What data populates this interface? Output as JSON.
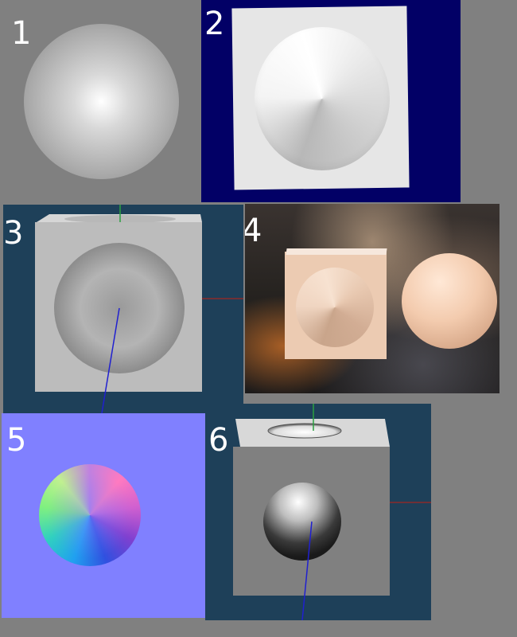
{
  "panels": [
    {
      "number": "1"
    },
    {
      "number": "2"
    },
    {
      "number": "3"
    },
    {
      "number": "4"
    },
    {
      "number": "5"
    },
    {
      "number": "6"
    }
  ],
  "colors": {
    "page_background": "#808080",
    "panel2_background": "#020066",
    "viewport_background": "#1e4059",
    "normal_map_background": "#8080ff",
    "axis_x": "#8a2a2a",
    "axis_y": "#2aa040",
    "axis_z": "#2020d0"
  }
}
